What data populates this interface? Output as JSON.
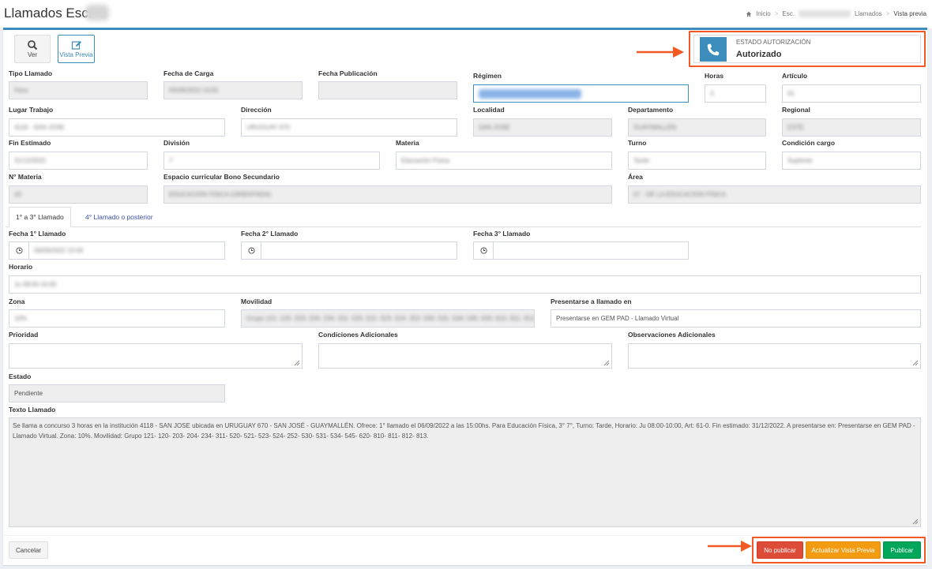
{
  "header": {
    "title": "Llamados Esc.",
    "breadcrumb": {
      "home": "Inicio",
      "school": "Esc.",
      "section": "Llamados",
      "current": "Vista previa"
    }
  },
  "toolbar": {
    "ver_label": "Ver",
    "preview_label": "Vista Previa"
  },
  "authorization": {
    "label": "ESTADO AUTORIZACIÓN",
    "value": "Autorizado",
    "icon": "phone-icon",
    "color": "#3c8dbc"
  },
  "fields": {
    "tipo_llamado": {
      "label": "Tipo Llamado",
      "value": "Hora"
    },
    "fecha_carga": {
      "label": "Fecha de Carga",
      "value": "05/09/2022 14:55"
    },
    "fecha_publicacion": {
      "label": "Fecha Publicación",
      "value": ""
    },
    "regimen": {
      "label": "Régimen",
      "value": ""
    },
    "horas": {
      "label": "Horas",
      "value": "3"
    },
    "articulo": {
      "label": "Artículo",
      "value": "61"
    },
    "lugar_trabajo": {
      "label": "Lugar Trabajo",
      "value": "4118 - SAN JOSE"
    },
    "direccion": {
      "label": "Dirección",
      "value": "URUGUAY 670"
    },
    "localidad": {
      "label": "Localidad",
      "value": "SAN JOSÉ"
    },
    "departamento": {
      "label": "Departamento",
      "value": "GUAYMALLÉN"
    },
    "regional": {
      "label": "Regional",
      "value": "ESTE"
    },
    "fin_estimado": {
      "label": "Fin Estimado",
      "value": "31/12/2022"
    },
    "division": {
      "label": "División",
      "value": "7"
    },
    "materia": {
      "label": "Materia",
      "value": "Educación Física"
    },
    "turno": {
      "label": "Turno",
      "value": "Tarde"
    },
    "condicion_cargo": {
      "label": "Condición cargo",
      "value": "Suplente"
    },
    "n_materia": {
      "label": "N° Materia",
      "value": "43"
    },
    "espacio_curricular": {
      "label": "Espacio curricular Bono Secundario",
      "value": "EDUCACIÓN FÍSICA (ORIENTADA)"
    },
    "area": {
      "label": "Área",
      "value": "07 - DE LA EDUCACIÓN FÍSICA"
    }
  },
  "tabs": [
    {
      "label": "1° a 3° Llamado"
    },
    {
      "label": "4° Llamado o posterior"
    }
  ],
  "llamados": {
    "fecha1": {
      "label": "Fecha 1° Llamado",
      "value": "06/09/2022 15:00"
    },
    "fecha2": {
      "label": "Fecha 2° Llamado",
      "value": ""
    },
    "fecha3": {
      "label": "Fecha 3° Llamado",
      "value": ""
    },
    "horario": {
      "label": "Horario",
      "value": "Ju 08:00-10:00"
    },
    "zona": {
      "label": "Zona",
      "value": "10%"
    },
    "movilidad": {
      "label": "Movilidad",
      "value": "Grupo 121- 120- 203- 204- 234- 311- 520- 521- 523- 524- 252- 530- 531- 534- 545- 620- 810- 811- 812- 8"
    },
    "presentarse": {
      "label": "Presentarse a llamado en",
      "value": "Presentarse en GEM PAD - Llamado Virtual"
    },
    "prioridad": {
      "label": "Prioridad"
    },
    "condiciones": {
      "label": "Condiciones Adicionales"
    },
    "observaciones": {
      "label": "Observaciones Adicionales"
    },
    "estado": {
      "label": "Estado",
      "value": "Pendiente"
    },
    "texto": {
      "label": "Texto Llamado",
      "value": "Se llama a concurso 3 horas en la institución 4118 - SAN JOSE ubicada en URUGUAY 670 - SAN JOSÉ - GUAYMALLÉN. Ofrece: 1° llamado el 06/09/2022 a las 15:00hs. Para Educación Física, 3° 7°, Turno: Tarde, Horario: Ju 08:00-10:00, Art: 61-0. Fin estimado: 31/12/2022. A presentarse en: Presentarse en GEM PAD - Llamado Virtual. Zona: 10%. Movilidad: Grupo 121- 120- 203- 204- 234- 311- 520- 521- 523- 524- 252- 530- 531- 534- 545- 620- 810- 811- 812- 813."
    }
  },
  "footer": {
    "cancel": "Cancelar",
    "no_publicar": "No publicar",
    "actualizar": "Actualizar Vista Previa",
    "publicar": "Publicar"
  },
  "colors": {
    "primary": "#3c8dbc",
    "danger": "#dd4b39",
    "warning": "#f39c12",
    "success": "#00a65a",
    "highlight": "#f15a24"
  }
}
